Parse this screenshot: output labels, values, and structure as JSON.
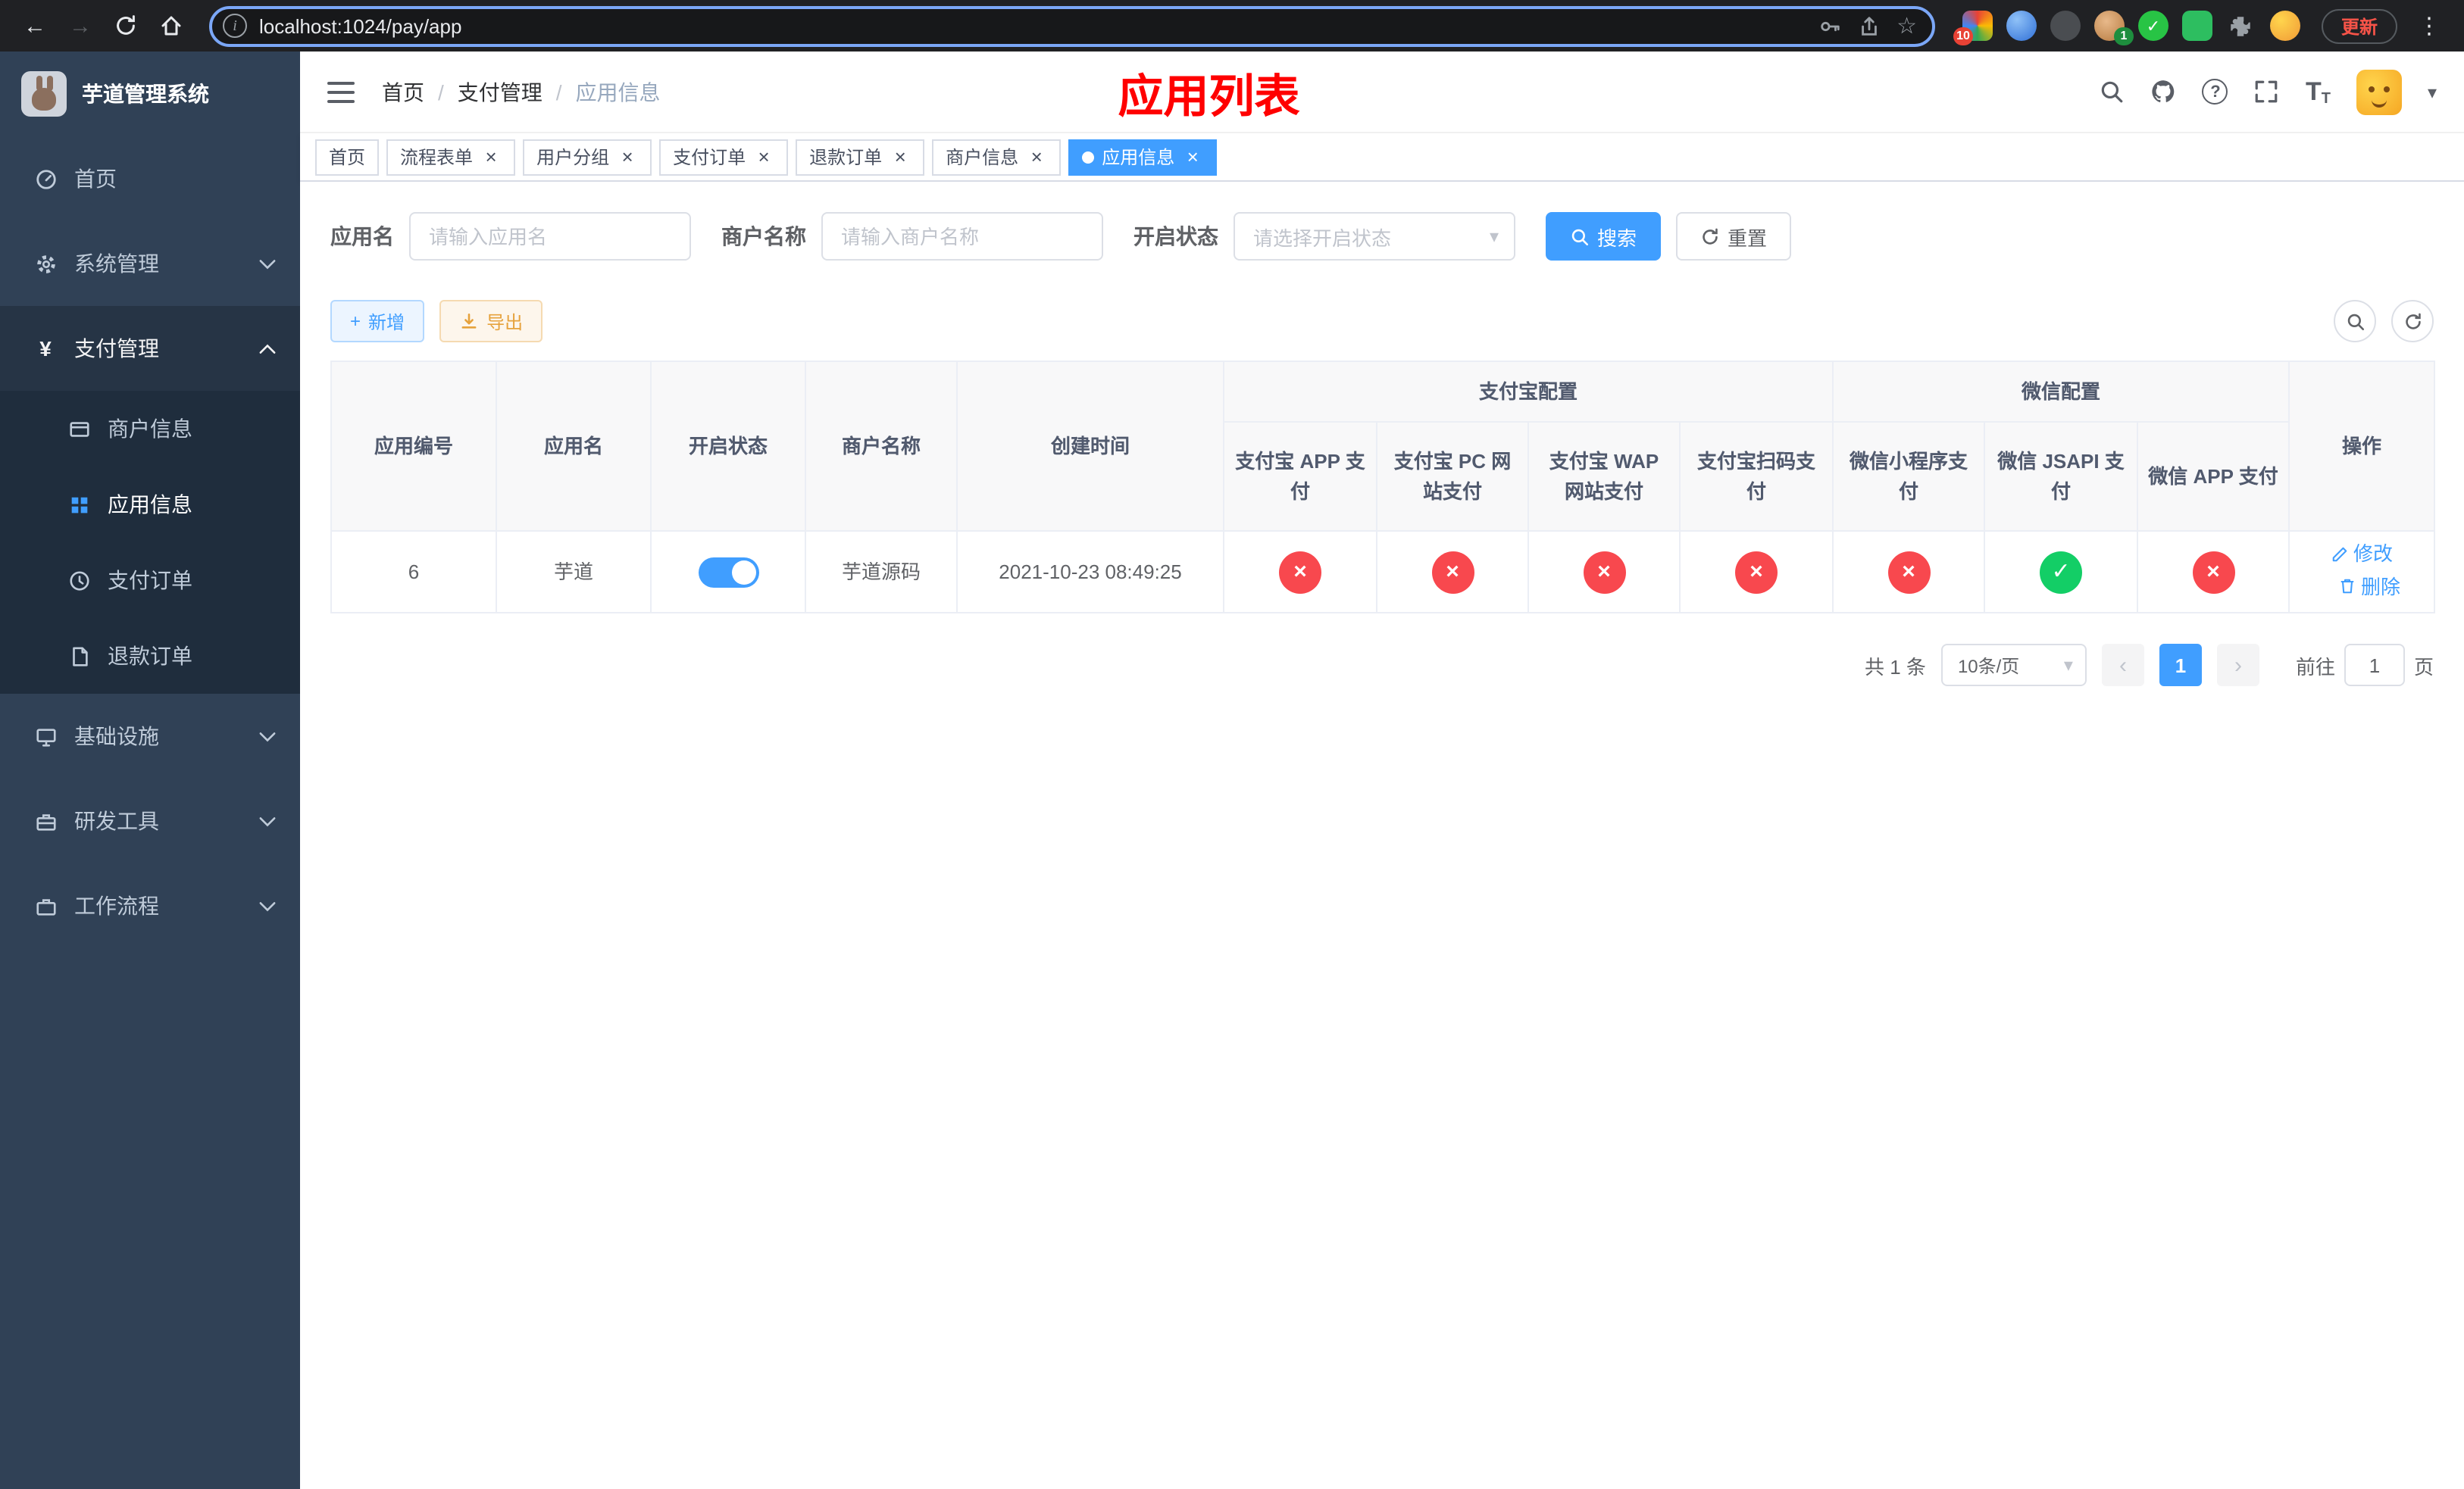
{
  "colors": {
    "accent": "#409EFF",
    "danger": "#f8484e",
    "success": "#13ce66",
    "warning": "#e6a23c",
    "title_red": "#ff0000",
    "sidebar_bg": "#304156",
    "sidebar_sub_bg": "#1f2d3d"
  },
  "browser": {
    "url": "localhost:1024/pay/app",
    "update_label": "更新",
    "extensions_badge": "10",
    "profile_badge": "1"
  },
  "glyphs": {
    "back": "←",
    "forward": "→",
    "bookmark_star": "☆",
    "menu_dots": "⋮",
    "info": "i",
    "check": "✓",
    "cross": "×",
    "close": "×",
    "plus": "+",
    "caret_down": "▾",
    "chevron_left": "‹",
    "chevron_right": "›",
    "question": "?",
    "yen": "¥",
    "font_size": "T",
    "breadcrumb_sep": "/"
  },
  "sidebar": {
    "title": "芋道管理系统",
    "items": [
      {
        "label": "首页"
      },
      {
        "label": "系统管理"
      },
      {
        "label": "支付管理",
        "children": [
          {
            "label": "商户信息"
          },
          {
            "label": "应用信息"
          },
          {
            "label": "支付订单"
          },
          {
            "label": "退款订单"
          }
        ]
      },
      {
        "label": "基础设施"
      },
      {
        "label": "研发工具"
      },
      {
        "label": "工作流程"
      }
    ]
  },
  "header": {
    "breadcrumb": [
      "首页",
      "支付管理",
      "应用信息"
    ],
    "page_title": "应用列表"
  },
  "tabs": [
    {
      "label": "首页",
      "closable": false,
      "active": false
    },
    {
      "label": "流程表单",
      "closable": true,
      "active": false
    },
    {
      "label": "用户分组",
      "closable": true,
      "active": false
    },
    {
      "label": "支付订单",
      "closable": true,
      "active": false
    },
    {
      "label": "退款订单",
      "closable": true,
      "active": false
    },
    {
      "label": "商户信息",
      "closable": true,
      "active": false
    },
    {
      "label": "应用信息",
      "closable": true,
      "active": true
    }
  ],
  "filters": {
    "app_name_label": "应用名",
    "app_name_placeholder": "请输入应用名",
    "merchant_label": "商户名称",
    "merchant_placeholder": "请输入商户名称",
    "status_label": "开启状态",
    "status_placeholder": "请选择开启状态",
    "search_label": "搜索",
    "reset_label": "重置"
  },
  "toolbar": {
    "add_label": "新增",
    "export_label": "导出"
  },
  "table": {
    "group_alipay": "支付宝配置",
    "group_wechat": "微信配置",
    "columns": [
      "应用编号",
      "应用名",
      "开启状态",
      "商户名称",
      "创建时间",
      "支付宝 APP 支付",
      "支付宝 PC 网站支付",
      "支付宝 WAP 网站支付",
      "支付宝扫码支付",
      "微信小程序支付",
      "微信 JSAPI 支付",
      "微信 APP 支付",
      "操作"
    ],
    "rows": [
      {
        "id": "6",
        "name": "芋道",
        "enabled": true,
        "merchant": "芋道源码",
        "created": "2021-10-23 08:49:25",
        "configs": [
          false,
          false,
          false,
          false,
          false,
          true,
          false
        ],
        "edit_label": "修改",
        "delete_label": "删除"
      }
    ]
  },
  "pagination": {
    "total": "共 1 条",
    "page_size": "10条/页",
    "page": "1",
    "goto_label": "前往",
    "goto_value": "1",
    "goto_suffix": "页"
  }
}
